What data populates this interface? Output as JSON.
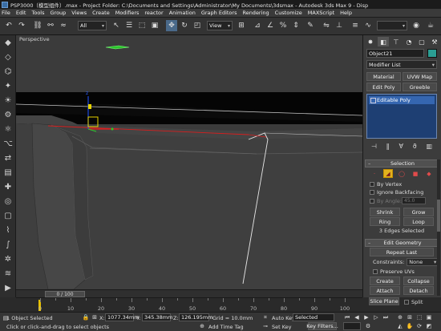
{
  "titlebar": {
    "title": "PSP3000（模型组件）.max - Project Folder: C:\\Documents and Settings\\Administrator\\My Documents\\3dsmax - Autodesk 3ds Max 9 - Disp"
  },
  "menus": [
    "File",
    "Edit",
    "Tools",
    "Group",
    "Views",
    "Create",
    "Modifiers",
    "reactor",
    "Animation",
    "Graph Editors",
    "Rendering",
    "Customize",
    "MAXScript",
    "Help"
  ],
  "toolbar": {
    "selection_filter": "All",
    "ref_coord": "View"
  },
  "viewport": {
    "label": "Perspective"
  },
  "command_panel": {
    "object_name": "Object21",
    "object_color": "#2b9e93",
    "modifier_list": "Modifier List",
    "buttons": [
      "Material",
      "UVW Map",
      "Edit Poly",
      "Greeble"
    ],
    "stack_item": "Editable Poly",
    "selection": {
      "title": "Selection",
      "by_vertex": "By Vertex",
      "ignore_backfacing": "Ignore Backfacing",
      "by_angle": "By Angle:",
      "angle_value": "45.0",
      "shrink": "Shrink",
      "grow": "Grow",
      "ring": "Ring",
      "loop": "Loop",
      "status": "3 Edges Selected"
    },
    "edit_geometry": {
      "title": "Edit Geometry",
      "repeat_last": "Repeat Last",
      "constraints_label": "Constraints:",
      "constraints_value": "None",
      "preserve_uvs": "Preserve UVs",
      "create": "Create",
      "collapse": "Collapse",
      "attach": "Attach",
      "detach": "Detach",
      "slice_plane": "Slice Plane",
      "split": "Split"
    }
  },
  "timeline": {
    "slider": "0 / 100",
    "ticks": [
      "0",
      "10",
      "20",
      "30",
      "40",
      "50",
      "60",
      "70",
      "80",
      "90",
      "100"
    ]
  },
  "statusbar": {
    "selected": "1 Object Selected",
    "prompt": "Click or click-and-drag to select objects",
    "x_label": "X:",
    "x_value": "1077.34mm",
    "y_label": "Y:",
    "y_value": "345.38mm",
    "z_label": "Z:",
    "z_value": "126.195mm",
    "grid": "Grid = 10.0mm",
    "auto_key": "Auto Key",
    "selected_dropdown": "Selected",
    "set_key": "Set Key",
    "key_filters": "Key Filters...",
    "add_time_tag": "Add Time Tag"
  }
}
